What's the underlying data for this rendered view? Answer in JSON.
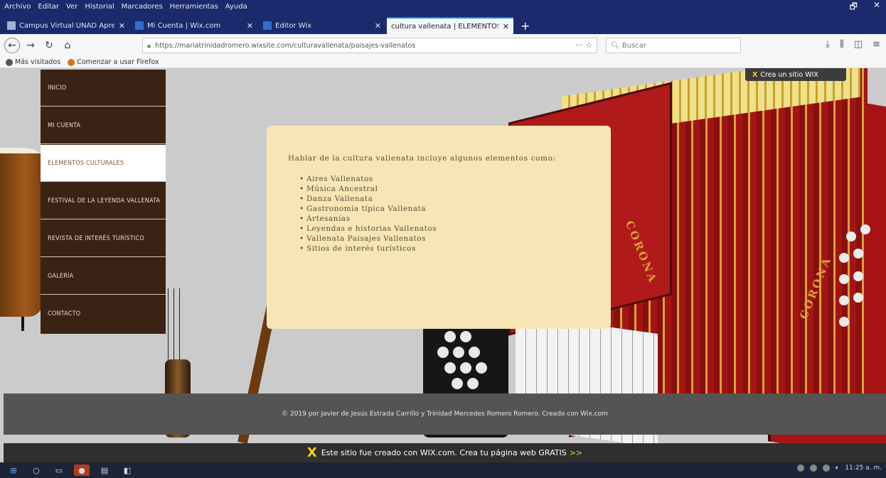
{
  "browser": {
    "menus": [
      "Archivo",
      "Editar",
      "Ver",
      "Historial",
      "Marcadores",
      "Herramientas",
      "Ayuda"
    ],
    "window_controls": [
      "🗗",
      "✕"
    ],
    "tabs": [
      {
        "title": "Campus Virtual UNAD Aprendiendo",
        "active": false
      },
      {
        "title": "Mi Cuenta | Wix.com",
        "active": false
      },
      {
        "title": "Editor Wix",
        "active": false
      },
      {
        "title": "cultura vallenata | ELEMENTOS CULTU",
        "active": true
      }
    ],
    "url": "https://mariatrinidadromero.wixsite.com/culturavallenata/paisajes-vallenatos",
    "search_placeholder": "Buscar",
    "bookmarks": [
      "Más visitados",
      "Comenzar a usar Firefox"
    ]
  },
  "site": {
    "nav": [
      {
        "label": "INICIO"
      },
      {
        "label": "MI CUENTA"
      },
      {
        "label": "ELEMENTOS CULTURALES"
      },
      {
        "label": "FESTIVAL DE LA LEYENDA VALLENATA"
      },
      {
        "label": "REVISTA DE INTERÉS TURÍSTICO"
      },
      {
        "label": "GALERÍA"
      },
      {
        "label": "CONTACTO"
      }
    ],
    "active_nav_index": 2,
    "wix_badge": "Crea un sitio WIX",
    "content": {
      "intro": "Hablar de la cultura vallenata incluye algunos elementos como:",
      "items": [
        "Aires Vallenatos",
        "Música Ancestral",
        "Danza Vallenata",
        "Gastronomía típica Vallenata",
        "Artesanías",
        " Leyendas e historias Vallenatos",
        "Vallenata Paisajes Vallenatos",
        "Sitios de interés turísticos"
      ]
    },
    "footer": "© 2019 por Javier de Jesús Estrada Carrillo y Trinidad Mercedes Romero Romero. Creado con Wix.com",
    "wix_bar": {
      "text": "Este sitio fue creado con WIX.com. Crea tu página web GRATIS",
      "cta": ">>"
    },
    "accordion_brand": "CORONA"
  },
  "taskbar": {
    "clock": "11:25 a. m."
  },
  "colors": {
    "nav_bg": "#3a2214",
    "content_bg": "#f7e6b5",
    "wix_yellow": "#f7d21b",
    "firefox_blue": "#1a2a6c"
  }
}
